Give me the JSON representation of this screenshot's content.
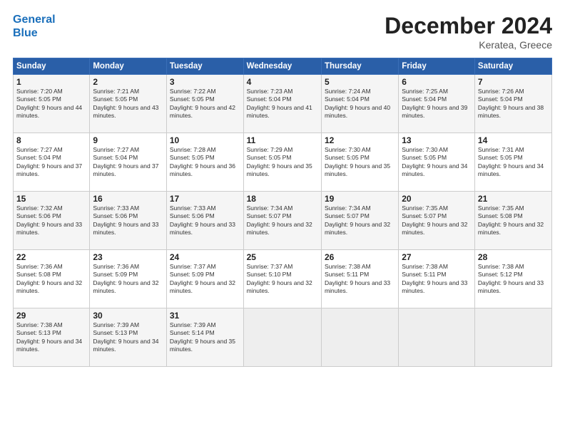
{
  "header": {
    "logo_line1": "General",
    "logo_line2": "Blue",
    "title": "December 2024",
    "subtitle": "Keratea, Greece"
  },
  "columns": [
    "Sunday",
    "Monday",
    "Tuesday",
    "Wednesday",
    "Thursday",
    "Friday",
    "Saturday"
  ],
  "weeks": [
    [
      {
        "day": "1",
        "sunrise": "Sunrise: 7:20 AM",
        "sunset": "Sunset: 5:05 PM",
        "daylight": "Daylight: 9 hours and 44 minutes."
      },
      {
        "day": "2",
        "sunrise": "Sunrise: 7:21 AM",
        "sunset": "Sunset: 5:05 PM",
        "daylight": "Daylight: 9 hours and 43 minutes."
      },
      {
        "day": "3",
        "sunrise": "Sunrise: 7:22 AM",
        "sunset": "Sunset: 5:05 PM",
        "daylight": "Daylight: 9 hours and 42 minutes."
      },
      {
        "day": "4",
        "sunrise": "Sunrise: 7:23 AM",
        "sunset": "Sunset: 5:04 PM",
        "daylight": "Daylight: 9 hours and 41 minutes."
      },
      {
        "day": "5",
        "sunrise": "Sunrise: 7:24 AM",
        "sunset": "Sunset: 5:04 PM",
        "daylight": "Daylight: 9 hours and 40 minutes."
      },
      {
        "day": "6",
        "sunrise": "Sunrise: 7:25 AM",
        "sunset": "Sunset: 5:04 PM",
        "daylight": "Daylight: 9 hours and 39 minutes."
      },
      {
        "day": "7",
        "sunrise": "Sunrise: 7:26 AM",
        "sunset": "Sunset: 5:04 PM",
        "daylight": "Daylight: 9 hours and 38 minutes."
      }
    ],
    [
      {
        "day": "8",
        "sunrise": "Sunrise: 7:27 AM",
        "sunset": "Sunset: 5:04 PM",
        "daylight": "Daylight: 9 hours and 37 minutes."
      },
      {
        "day": "9",
        "sunrise": "Sunrise: 7:27 AM",
        "sunset": "Sunset: 5:04 PM",
        "daylight": "Daylight: 9 hours and 37 minutes."
      },
      {
        "day": "10",
        "sunrise": "Sunrise: 7:28 AM",
        "sunset": "Sunset: 5:05 PM",
        "daylight": "Daylight: 9 hours and 36 minutes."
      },
      {
        "day": "11",
        "sunrise": "Sunrise: 7:29 AM",
        "sunset": "Sunset: 5:05 PM",
        "daylight": "Daylight: 9 hours and 35 minutes."
      },
      {
        "day": "12",
        "sunrise": "Sunrise: 7:30 AM",
        "sunset": "Sunset: 5:05 PM",
        "daylight": "Daylight: 9 hours and 35 minutes."
      },
      {
        "day": "13",
        "sunrise": "Sunrise: 7:30 AM",
        "sunset": "Sunset: 5:05 PM",
        "daylight": "Daylight: 9 hours and 34 minutes."
      },
      {
        "day": "14",
        "sunrise": "Sunrise: 7:31 AM",
        "sunset": "Sunset: 5:05 PM",
        "daylight": "Daylight: 9 hours and 34 minutes."
      }
    ],
    [
      {
        "day": "15",
        "sunrise": "Sunrise: 7:32 AM",
        "sunset": "Sunset: 5:06 PM",
        "daylight": "Daylight: 9 hours and 33 minutes."
      },
      {
        "day": "16",
        "sunrise": "Sunrise: 7:33 AM",
        "sunset": "Sunset: 5:06 PM",
        "daylight": "Daylight: 9 hours and 33 minutes."
      },
      {
        "day": "17",
        "sunrise": "Sunrise: 7:33 AM",
        "sunset": "Sunset: 5:06 PM",
        "daylight": "Daylight: 9 hours and 33 minutes."
      },
      {
        "day": "18",
        "sunrise": "Sunrise: 7:34 AM",
        "sunset": "Sunset: 5:07 PM",
        "daylight": "Daylight: 9 hours and 32 minutes."
      },
      {
        "day": "19",
        "sunrise": "Sunrise: 7:34 AM",
        "sunset": "Sunset: 5:07 PM",
        "daylight": "Daylight: 9 hours and 32 minutes."
      },
      {
        "day": "20",
        "sunrise": "Sunrise: 7:35 AM",
        "sunset": "Sunset: 5:07 PM",
        "daylight": "Daylight: 9 hours and 32 minutes."
      },
      {
        "day": "21",
        "sunrise": "Sunrise: 7:35 AM",
        "sunset": "Sunset: 5:08 PM",
        "daylight": "Daylight: 9 hours and 32 minutes."
      }
    ],
    [
      {
        "day": "22",
        "sunrise": "Sunrise: 7:36 AM",
        "sunset": "Sunset: 5:08 PM",
        "daylight": "Daylight: 9 hours and 32 minutes."
      },
      {
        "day": "23",
        "sunrise": "Sunrise: 7:36 AM",
        "sunset": "Sunset: 5:09 PM",
        "daylight": "Daylight: 9 hours and 32 minutes."
      },
      {
        "day": "24",
        "sunrise": "Sunrise: 7:37 AM",
        "sunset": "Sunset: 5:09 PM",
        "daylight": "Daylight: 9 hours and 32 minutes."
      },
      {
        "day": "25",
        "sunrise": "Sunrise: 7:37 AM",
        "sunset": "Sunset: 5:10 PM",
        "daylight": "Daylight: 9 hours and 32 minutes."
      },
      {
        "day": "26",
        "sunrise": "Sunrise: 7:38 AM",
        "sunset": "Sunset: 5:11 PM",
        "daylight": "Daylight: 9 hours and 33 minutes."
      },
      {
        "day": "27",
        "sunrise": "Sunrise: 7:38 AM",
        "sunset": "Sunset: 5:11 PM",
        "daylight": "Daylight: 9 hours and 33 minutes."
      },
      {
        "day": "28",
        "sunrise": "Sunrise: 7:38 AM",
        "sunset": "Sunset: 5:12 PM",
        "daylight": "Daylight: 9 hours and 33 minutes."
      }
    ],
    [
      {
        "day": "29",
        "sunrise": "Sunrise: 7:38 AM",
        "sunset": "Sunset: 5:13 PM",
        "daylight": "Daylight: 9 hours and 34 minutes."
      },
      {
        "day": "30",
        "sunrise": "Sunrise: 7:39 AM",
        "sunset": "Sunset: 5:13 PM",
        "daylight": "Daylight: 9 hours and 34 minutes."
      },
      {
        "day": "31",
        "sunrise": "Sunrise: 7:39 AM",
        "sunset": "Sunset: 5:14 PM",
        "daylight": "Daylight: 9 hours and 35 minutes."
      },
      null,
      null,
      null,
      null
    ]
  ]
}
